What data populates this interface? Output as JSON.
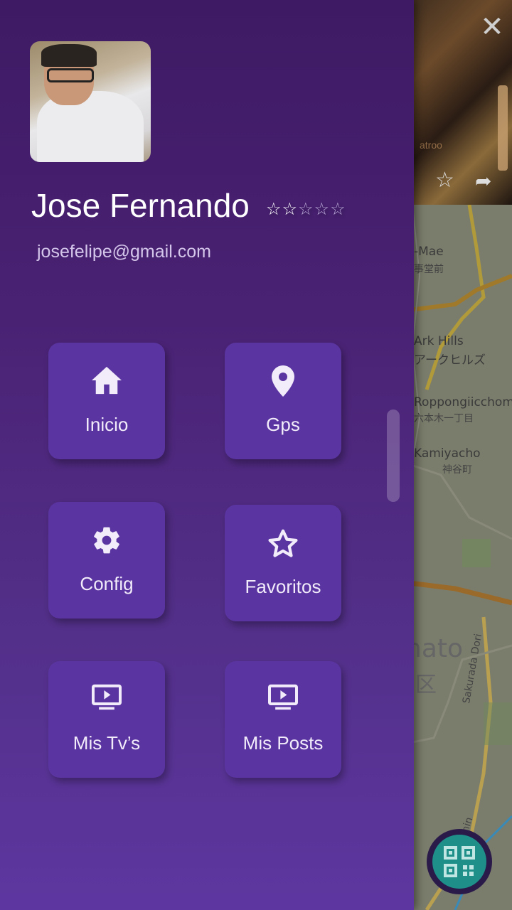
{
  "profile": {
    "name": "Jose Fernando",
    "email": "josefelipe@gmail.com",
    "rating": 2,
    "rating_max": 5,
    "stars_filled": "☆☆",
    "stars_empty": "☆☆☆"
  },
  "menu": {
    "items": [
      {
        "label": "Inicio",
        "icon": "home-icon"
      },
      {
        "label": "Gps",
        "icon": "location-pin-icon"
      },
      {
        "label": "Config",
        "icon": "gear-icon"
      },
      {
        "label": "Favoritos",
        "icon": "star-icon"
      },
      {
        "label": "Mis Tv’s",
        "icon": "tv-play-icon"
      },
      {
        "label": "Mis Posts",
        "icon": "tv-play-icon"
      }
    ]
  },
  "background_map": {
    "labels": [
      "-Mae",
      "事堂前",
      "Ark Hills",
      "アークヒルズ",
      "Roppongiicchom",
      "六本木一丁目",
      "Kamiyacho",
      "神谷町",
      "nato",
      "区",
      "Sakurada Dori",
      "Keihin"
    ],
    "photo_sign": "atroo"
  },
  "controls": {
    "close_icon": "close-icon",
    "qr_icon": "qr-code-icon"
  },
  "colors": {
    "drawer_top": "#3e1a64",
    "drawer_bottom": "#5e36a0",
    "tile": "#5a34a0",
    "fab": "#1f8f8a"
  }
}
